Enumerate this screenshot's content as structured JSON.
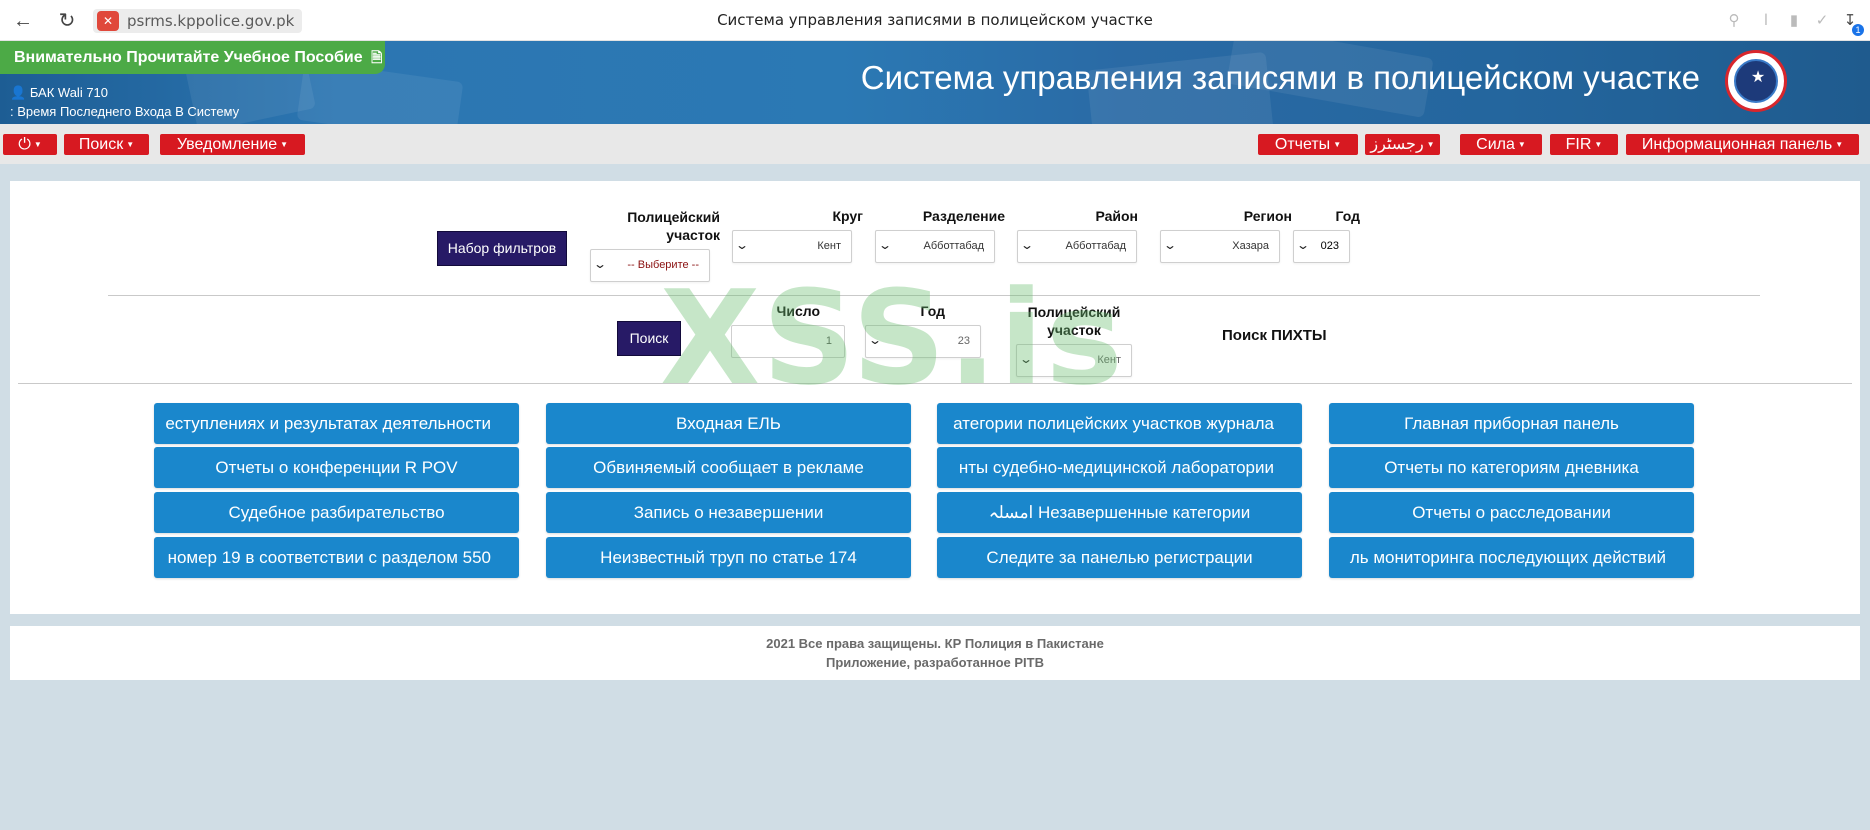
{
  "browser": {
    "url": "psrms.kppolice.gov.pk",
    "tab_title": "Система управления записями в полицейском участке",
    "download_badge": "1"
  },
  "header": {
    "manual_button": "Внимательно Прочитайте Учебное Пособие",
    "user": "БАК Wali 710",
    "last_login": ": Время Последнего Входа В Систему",
    "app_title": "Система управления записями в полицейском участке"
  },
  "nav": {
    "left": [
      {
        "label": "",
        "icon": "power-icon"
      },
      {
        "label": "Поиск"
      },
      {
        "label": "Уведомление"
      }
    ],
    "right": [
      {
        "label": "Отчеты"
      },
      {
        "label": "رجسٹرز"
      },
      {
        "label": "Сила"
      },
      {
        "label": "FIR"
      },
      {
        "label": "Информационная панель"
      }
    ]
  },
  "filters": {
    "apply_button": "Набор фильтров",
    "station": {
      "label": "Полицейский участок",
      "value": "-- Выберите --"
    },
    "circle": {
      "label": "Круг",
      "value": "Кент"
    },
    "division": {
      "label": "Разделение",
      "value": "Абботтабад"
    },
    "district": {
      "label": "Район",
      "value": "Абботтабад"
    },
    "region": {
      "label": "Регион",
      "value": "Хазара"
    },
    "year": {
      "label": "Год",
      "value": "023"
    }
  },
  "search": {
    "button": "Поиск",
    "number": {
      "label": "Число",
      "value": "1"
    },
    "year": {
      "label": "Год",
      "value": "23"
    },
    "station": {
      "label": "Полицейский участок",
      "value": "Кент"
    },
    "title": "Поиск ПИХТЫ"
  },
  "tiles": [
    [
      "еступлениях и результатах деятельности",
      "Отчеты о конференции R POV",
      "Судебное разбирательство",
      "номер 19 в соответствии с разделом 550"
    ],
    [
      "Входная ЕЛЬ",
      "Обвиняемый сообщает в рекламе",
      "Запись о незавершении",
      "Неизвестный труп по статье 174"
    ],
    [
      "атегории полицейских участков журнала",
      "нты судебно-медицинской лаборатории",
      "امسلہ Незавершенные категории",
      "Следите за панелью регистрации"
    ],
    [
      "Главная приборная панель",
      "Отчеты по категориям дневника",
      "Отчеты о расследовании",
      "ль мониторинга последующих действий"
    ]
  ],
  "footer": {
    "copyright": "2021 Все права защищены. КР Полиция в Пакистане",
    "developer": "Приложение, разработанное PITB"
  },
  "watermark": "XSS.is"
}
